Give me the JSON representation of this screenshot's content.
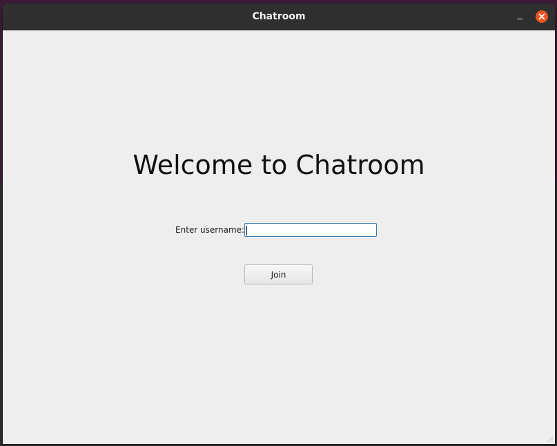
{
  "window": {
    "title": "Chatroom"
  },
  "titlebar": {
    "minimize_icon": "minimize-icon",
    "close_icon": "close-icon",
    "close_color": "#e95420"
  },
  "main": {
    "heading": "Welcome to Chatroom",
    "username_label": "Enter username:",
    "username_value": "",
    "join_label": "Join"
  },
  "colors": {
    "titlebar_bg": "#2f2f2f",
    "content_bg": "#eeeeee",
    "input_border": "#3c7bb3"
  }
}
